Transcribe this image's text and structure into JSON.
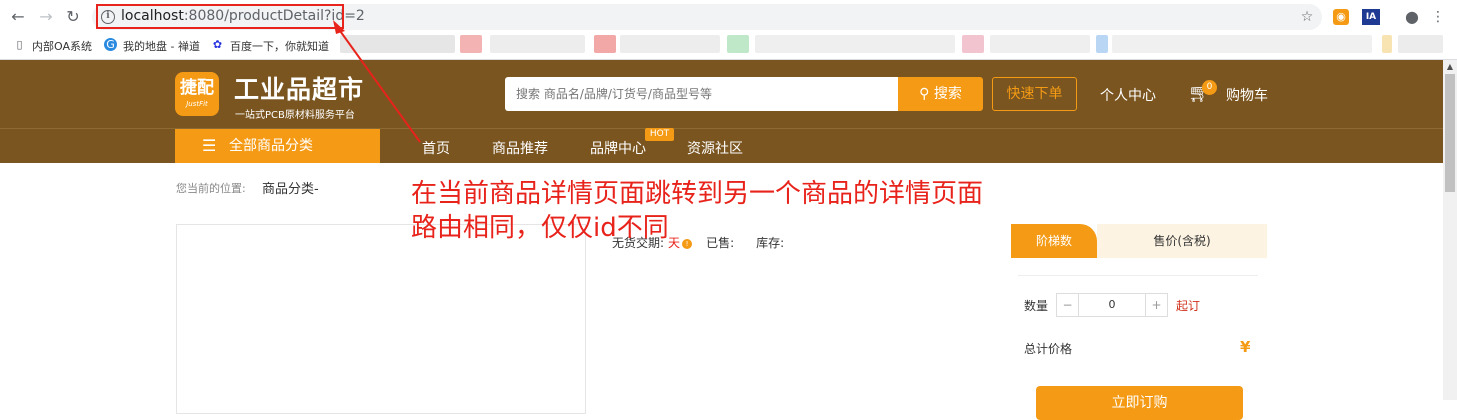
{
  "browser": {
    "url_host": "localhost",
    "url_rest": ":8080/productDetail?id=2",
    "bookmarks": [
      "内部OA系统",
      "我的地盘 - 禅道",
      "百度一下，你就知道"
    ]
  },
  "header": {
    "logo_zh": "捷配",
    "logo_en": "JustFit",
    "title": "工业品超市",
    "slogan": "一站式PCB原材料服务平台",
    "search_placeholder": "搜索 商品名/品牌/订货号/商品型号等",
    "search_button": "搜索",
    "quick_order": "快速下单",
    "user_center": "个人中心",
    "cart_count": "0",
    "cart_label": "购物车"
  },
  "nav": {
    "all_categories": "全部商品分类",
    "items": [
      "首页",
      "商品推荐",
      "品牌中心",
      "资源社区"
    ],
    "hot_badge": "HOT"
  },
  "breadcrumb": {
    "label": "您当前的位置:",
    "value": "商品分类-"
  },
  "product": {
    "delivery_label": "无货交期:",
    "delivery_value": "天",
    "sold_label": "已售:",
    "stock_label": "库存:"
  },
  "price_panel": {
    "tab_tier": "阶梯数",
    "tab_price": "售价(含税)",
    "qty_label": "数量",
    "qty_minus": "−",
    "qty_value": "0",
    "qty_plus": "+",
    "moq_label": "起订",
    "total_label": "总计价格",
    "currency": "¥",
    "buy_button": "立即订购"
  },
  "annotation": {
    "line1": "在当前商品详情页面跳转到另一个商品的详情页面",
    "line2": "路由相同，仅仅id不同"
  },
  "colors": {
    "header_brown": "#7a5520",
    "accent_orange": "#f49a14",
    "annotation_red": "#e8231b"
  }
}
